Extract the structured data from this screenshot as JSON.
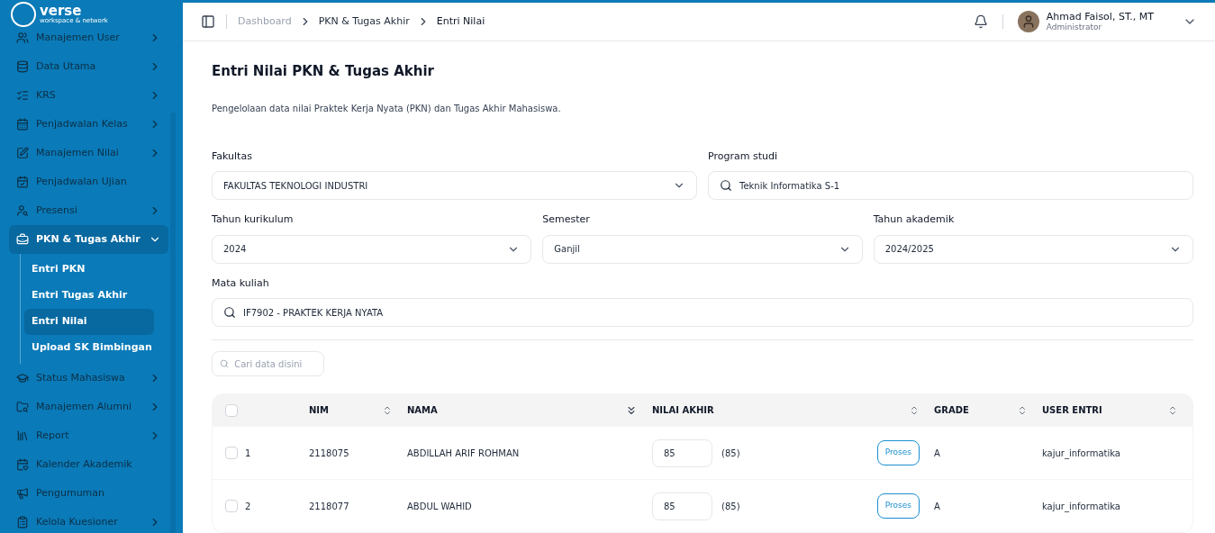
{
  "sidebar": {
    "logo": {
      "text": "verse",
      "tagline": "workspace & network"
    },
    "items": [
      {
        "label": "Manajemen User",
        "expandable": true,
        "expanded": false,
        "selected": false
      },
      {
        "label": "Data Utama",
        "expandable": true,
        "expanded": false,
        "selected": false
      },
      {
        "label": "KRS",
        "expandable": true,
        "expanded": false,
        "selected": false
      },
      {
        "label": "Penjadwalan Kelas",
        "expandable": true,
        "expanded": false,
        "selected": false
      },
      {
        "label": "Manajemen Nilai",
        "expandable": true,
        "expanded": false,
        "selected": false
      },
      {
        "label": "Penjadwalan Ujian",
        "expandable": false,
        "selected": false
      },
      {
        "label": "Presensi",
        "expandable": true,
        "expanded": false,
        "selected": false
      },
      {
        "label": "PKN & Tugas Akhir",
        "expandable": true,
        "expanded": true,
        "selected": true,
        "children": [
          {
            "label": "Entri PKN",
            "selected": false
          },
          {
            "label": "Entri Tugas Akhir",
            "selected": false
          },
          {
            "label": "Entri Nilai",
            "selected": true
          },
          {
            "label": "Upload SK Bimbingan",
            "selected": false
          }
        ]
      },
      {
        "label": "Status Mahasiswa",
        "expandable": true,
        "expanded": false,
        "selected": false
      },
      {
        "label": "Manajemen Alumni",
        "expandable": true,
        "expanded": false,
        "selected": false
      },
      {
        "label": "Report",
        "expandable": true,
        "expanded": false,
        "selected": false
      },
      {
        "label": "Kalender Akademik",
        "expandable": false,
        "selected": false
      },
      {
        "label": "Pengumuman",
        "expandable": false,
        "selected": false
      },
      {
        "label": "Kelola Kuesioner",
        "expandable": true,
        "expanded": false,
        "selected": false
      }
    ]
  },
  "breadcrumb": [
    {
      "label": "Dashboard",
      "current": false
    },
    {
      "label": "PKN & Tugas Akhir",
      "current": false
    },
    {
      "label": "Entri Nilai",
      "current": true
    }
  ],
  "user": {
    "name": "Ahmad Faisol, ST., MT",
    "role": "Administrator"
  },
  "page": {
    "title": "Entri Nilai PKN & Tugas Akhir",
    "description": "Pengelolaan data nilai Praktek Kerja Nyata (PKN) dan Tugas Akhir Mahasiswa."
  },
  "filters": [
    [
      {
        "label": "Fakultas",
        "kind": "select",
        "value": "FAKULTAS TEKNOLOGI INDUSTRI"
      },
      {
        "label": "Program studi",
        "kind": "search",
        "value": "Teknik Informatika S-1"
      }
    ],
    [
      {
        "label": "Tahun kurikulum",
        "kind": "select",
        "value": "2024"
      },
      {
        "label": "Semester",
        "kind": "select",
        "value": "Ganjil"
      },
      {
        "label": "Tahun akademik",
        "kind": "select",
        "value": "2024/2025"
      }
    ],
    [
      {
        "label": "Mata kuliah",
        "kind": "search",
        "value": "IF7902 - PRAKTEK KERJA NYATA"
      }
    ]
  ],
  "search": {
    "placeholder": "Cari data disini"
  },
  "table": {
    "select_all": {
      "checked": false
    },
    "columns": [
      {
        "label": "NIM",
        "kind": "sortable"
      },
      {
        "label": "NAMA",
        "kind": "sorted"
      },
      {
        "label": "NILAI AKHIR",
        "kind": "sortable"
      },
      {
        "label": "GRADE",
        "kind": "sortable"
      },
      {
        "label": "USER ENTRI",
        "kind": "sortable"
      }
    ],
    "rows": [
      {
        "checked": false,
        "no": "1",
        "nim": "2118075",
        "nama": "ABDILLAH ARIF ROHMAN",
        "nilai": "85",
        "nilai_reading": "(85)",
        "action": "Proses",
        "grade": "A",
        "user": "kajur_informatika"
      },
      {
        "checked": false,
        "no": "2",
        "nim": "2118077",
        "nama": "ABDUL WAHID",
        "nilai": "85",
        "nilai_reading": "(85)",
        "action": "Proses",
        "grade": "A",
        "user": "kajur_informatika"
      }
    ]
  }
}
